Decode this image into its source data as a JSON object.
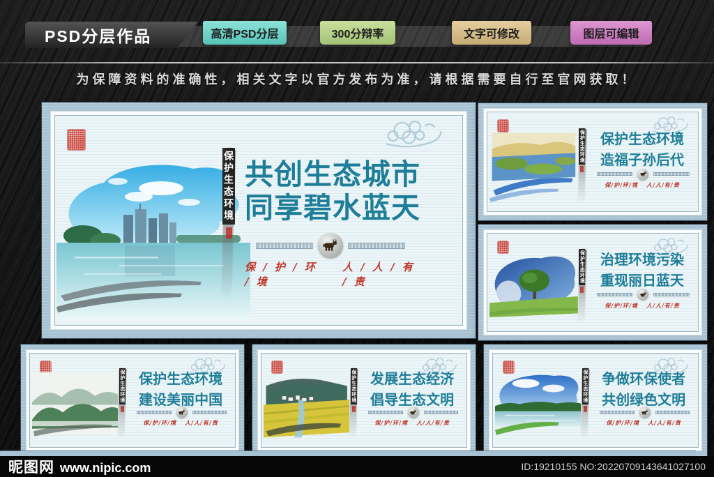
{
  "header": {
    "title": "PSD分层作品",
    "ribbons": [
      {
        "label": "高清PSD分层",
        "color": "#6fd2c9"
      },
      {
        "label": "300分辩率",
        "color": "#b7d18a"
      },
      {
        "label": "文字可修改",
        "color": "#d6bc8a"
      },
      {
        "label": "图层可编辑",
        "color": "#ce82c4"
      }
    ]
  },
  "notice": {
    "text": "为保障资料的准确性，相关文字以官方发布为准，请根据需要自行至官网获取！"
  },
  "shared": {
    "vertical_label": "保护生态环境",
    "slogan_left": "保 / 护 / 环 / 境",
    "slogan_right": "人 / 人 / 有 / 责",
    "slogan_left_small": "保/护/环/境",
    "slogan_right_small": "人/人/有/责"
  },
  "posters": {
    "main": {
      "line1": "共创生态城市",
      "line2": "同享碧水蓝天"
    },
    "right_top": {
      "line1": "保护生态环境",
      "line2": "造福子孙后代"
    },
    "right_middle": {
      "line1": "治理环境污染",
      "line2": "重现丽日蓝天"
    },
    "bottom_left": {
      "line1": "保护生态环境",
      "line2": "建设美丽中国"
    },
    "bottom_middle": {
      "line1": "发展生态经济",
      "line2": "倡导生态文明"
    },
    "bottom_right": {
      "line1": "争做环保使者",
      "line2": "共创绿色文明"
    }
  },
  "footer": {
    "site_name": "昵图网",
    "site_url": "www.nipic.com",
    "id_text": "ID:19210155 NO:20220709143641027100"
  },
  "colors": {
    "headline_teal": "#1e7d98",
    "slogan_red": "#c0372b",
    "frame_blue": "#a6c2d3",
    "poster_bg": "#ecf5f7",
    "notice_gray": "#dadada",
    "background_dark": "#151515"
  }
}
